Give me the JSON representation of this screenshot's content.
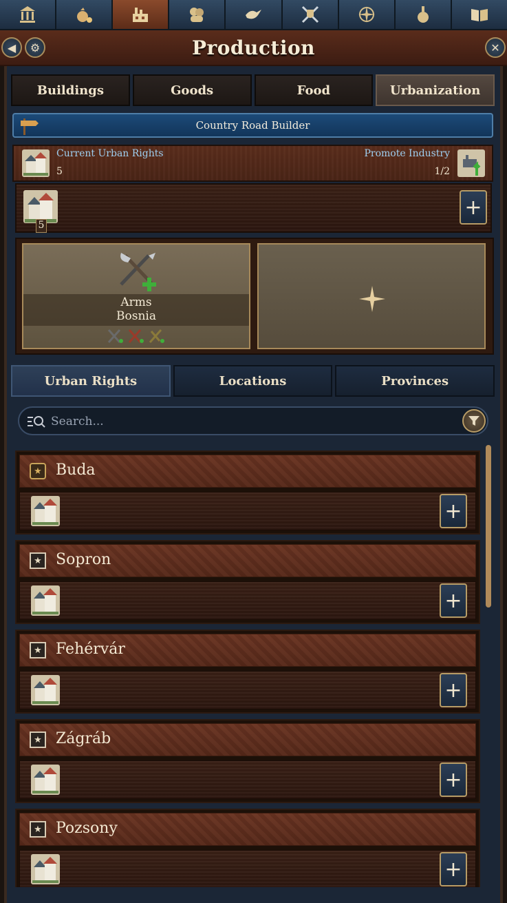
{
  "nav": {
    "tabs": [
      {
        "icon": "government-temple-icon",
        "active": false
      },
      {
        "icon": "economy-moneybag-icon",
        "active": false
      },
      {
        "icon": "production-buildings-icon",
        "active": true
      },
      {
        "icon": "estates-people-icon",
        "active": false
      },
      {
        "icon": "diplomacy-dove-icon",
        "active": false
      },
      {
        "icon": "military-shield-icon",
        "active": false
      },
      {
        "icon": "exploration-compass-icon",
        "active": false
      },
      {
        "icon": "religion-flask-icon",
        "active": false
      },
      {
        "icon": "knowledge-book-icon",
        "active": false
      }
    ]
  },
  "header": {
    "title": "Production"
  },
  "production_tabs": [
    "Buildings",
    "Goods",
    "Food",
    "Urbanization"
  ],
  "production_active": "Urbanization",
  "builder": {
    "label": "Country Road Builder"
  },
  "rights": {
    "current_label": "Current Urban Rights",
    "current_value": "5",
    "promote_label": "Promote Industry",
    "promote_value": "1/2"
  },
  "slot": {
    "badge": "5"
  },
  "cards": [
    {
      "good": "Arms",
      "location": "Bosnia"
    }
  ],
  "list_tabs": [
    "Urban Rights",
    "Locations",
    "Provinces"
  ],
  "list_active": "Urban Rights",
  "search": {
    "placeholder": "Search..."
  },
  "entries": [
    {
      "name": "Buda",
      "capital": true
    },
    {
      "name": "Sopron",
      "capital": false
    },
    {
      "name": "Fehérvár",
      "capital": false
    },
    {
      "name": "Zágráb",
      "capital": false
    },
    {
      "name": "Pozsony",
      "capital": false
    }
  ],
  "colors": {
    "accent_blue": "#1c4a78",
    "wood_red": "#5a2d1c",
    "label_blue": "#9ecff0",
    "gold_border": "#b79c66"
  }
}
